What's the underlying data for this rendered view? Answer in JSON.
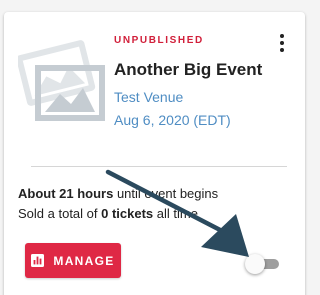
{
  "event_card": {
    "status": "UNPUBLISHED",
    "title": "Another Big Event",
    "venue": "Test Venue",
    "date": "Aug 6, 2020 (EDT)",
    "countdown_bold": "About 21 hours",
    "countdown_rest": " until event begins",
    "sold_prefix": "Sold a total of ",
    "sold_bold": "0 tickets",
    "sold_suffix": " all time",
    "manage_label": "MANAGE",
    "publish_toggle_on": false
  },
  "colors": {
    "accent": "#df2845",
    "status": "#d11f3a",
    "link": "#4f8dc3",
    "annotation_arrow": "#2b4a5e"
  },
  "icons": {
    "thumbnail": "image-placeholder-icon",
    "more": "more-vert-icon",
    "manage": "bar-chart-icon"
  }
}
